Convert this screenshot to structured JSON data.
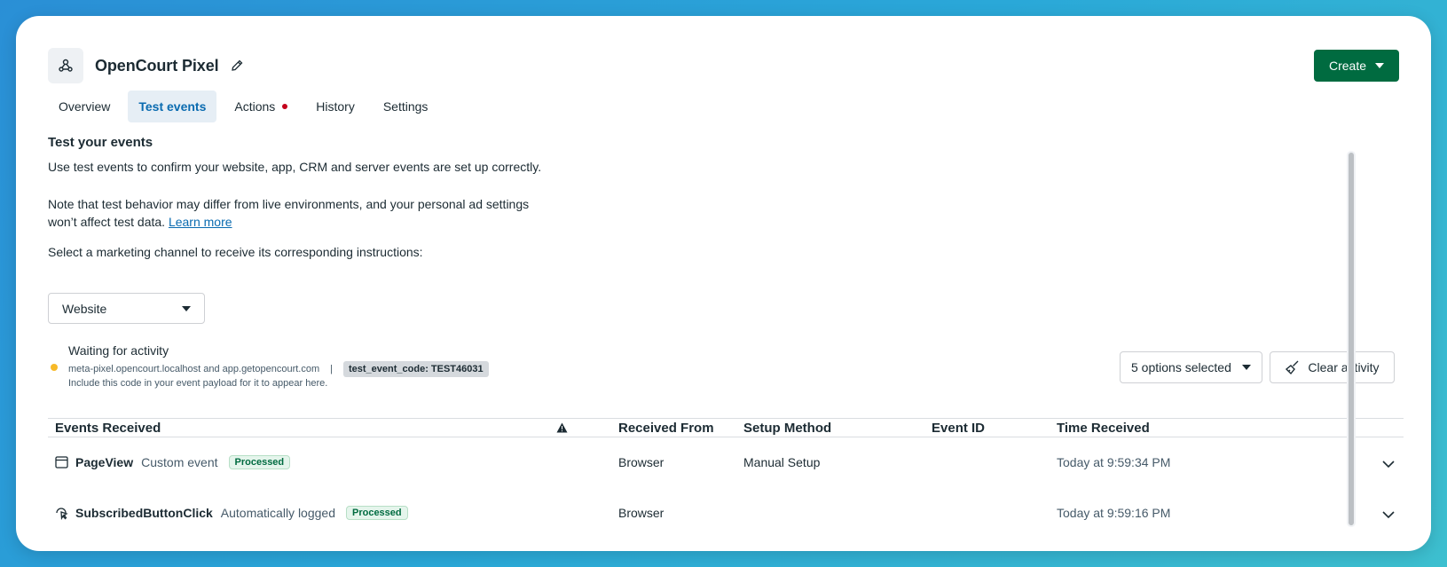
{
  "header": {
    "pixel_name": "OpenCourt Pixel",
    "create_label": "Create"
  },
  "tabs": [
    {
      "label": "Overview"
    },
    {
      "label": "Test events"
    },
    {
      "label": "Actions"
    },
    {
      "label": "History"
    },
    {
      "label": "Settings"
    }
  ],
  "test": {
    "title": "Test your events",
    "intro": "Use test events to confirm your website, app, CRM and server events are set up correctly.",
    "note_line1": "Note that test behavior may differ from live environments, and your personal ad settings",
    "note_line2": "won’t affect test data.",
    "learn_more": "Learn more",
    "channel_prompt": "Select a marketing channel to receive its corresponding instructions:",
    "channel_value": "Website"
  },
  "activity": {
    "status": "Waiting for activity",
    "domains": "meta-pixel.opencourt.localhost and app.getopencourt.com",
    "separator": "|",
    "code_chip": "test_event_code: TEST46031",
    "hint": "Include this code in your event payload for it to appear here.",
    "options_label": "5 options selected",
    "clear_label": "Clear activity"
  },
  "table": {
    "headers": {
      "events": "Events Received",
      "received_from": "Received From",
      "setup_method": "Setup Method",
      "event_id": "Event ID",
      "time": "Time Received"
    },
    "rows": [
      {
        "name": "PageView",
        "type": "Custom event",
        "status": "Processed",
        "from": "Browser",
        "method": "Manual Setup",
        "event_id": "",
        "time": "Today at 9:59:34 PM"
      },
      {
        "name": "SubscribedButtonClick",
        "type": "Automatically logged",
        "status": "Processed",
        "from": "Browser",
        "method": "",
        "event_id": "",
        "time": "Today at 9:59:16 PM"
      }
    ]
  },
  "colors": {
    "brand_green": "#006b40",
    "active_tab_text": "#0a6bb0",
    "waiting_dot": "#f7b928",
    "alert_dot": "#c4001b"
  }
}
